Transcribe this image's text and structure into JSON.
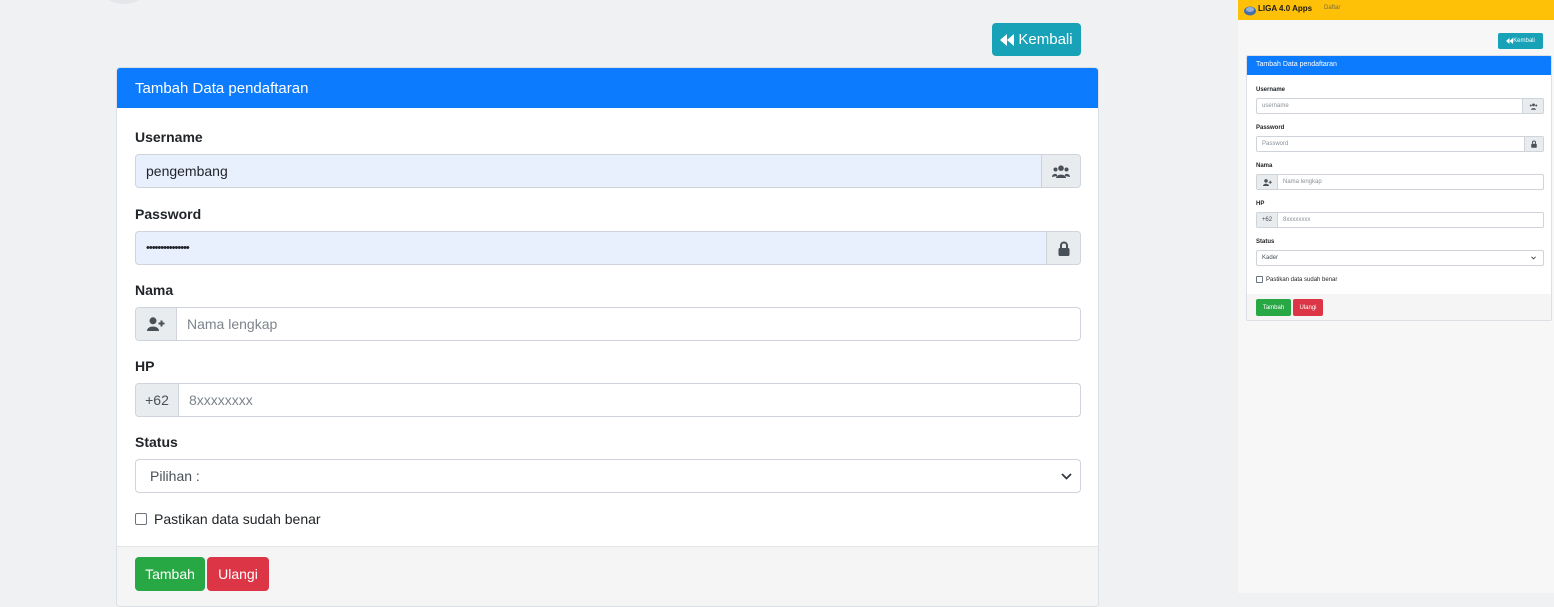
{
  "main": {
    "back_button": "Kembali",
    "card_title": "Tambah Data pendaftaran",
    "fields": {
      "username": {
        "label": "Username",
        "value": "pengembang"
      },
      "password": {
        "label": "Password",
        "value": "•••••••••••••••"
      },
      "nama": {
        "label": "Nama",
        "placeholder": "Nama lengkap"
      },
      "hp": {
        "label": "HP",
        "prefix": "+62",
        "placeholder": "8xxxxxxxx"
      },
      "status": {
        "label": "Status",
        "selected": "Pilihan :"
      }
    },
    "confirm_checkbox": "Pastikan data sudah benar",
    "submit_button": "Tambah",
    "reset_button": "Ulangi"
  },
  "preview": {
    "brand": "LIGA 4.0 Apps",
    "nav_link": "Daftar",
    "back_button": "Kembali",
    "card_title": "Tambah Data pendaftaran",
    "fields": {
      "username": {
        "label": "Username",
        "placeholder": "username"
      },
      "password": {
        "label": "Password",
        "placeholder": "Password"
      },
      "nama": {
        "label": "Nama",
        "placeholder": "Nama lengkap"
      },
      "hp": {
        "label": "HP",
        "prefix": "+62",
        "placeholder": "8xxxxxxxx"
      },
      "status": {
        "label": "Status",
        "selected": "Kader"
      }
    },
    "confirm_checkbox": "Pastikan data sudah benar",
    "submit_button": "Tambah",
    "reset_button": "Ulangi"
  },
  "colors": {
    "primary": "#0d7bfd",
    "info": "#17a2b8",
    "success": "#28a745",
    "danger": "#dc3545",
    "navbar": "#ffc107",
    "autofill": "#e8f0fe"
  },
  "icons": [
    "backward-icon",
    "users-icon",
    "lock-icon",
    "user-plus-icon",
    "chevron-down-icon",
    "logo-icon"
  ]
}
